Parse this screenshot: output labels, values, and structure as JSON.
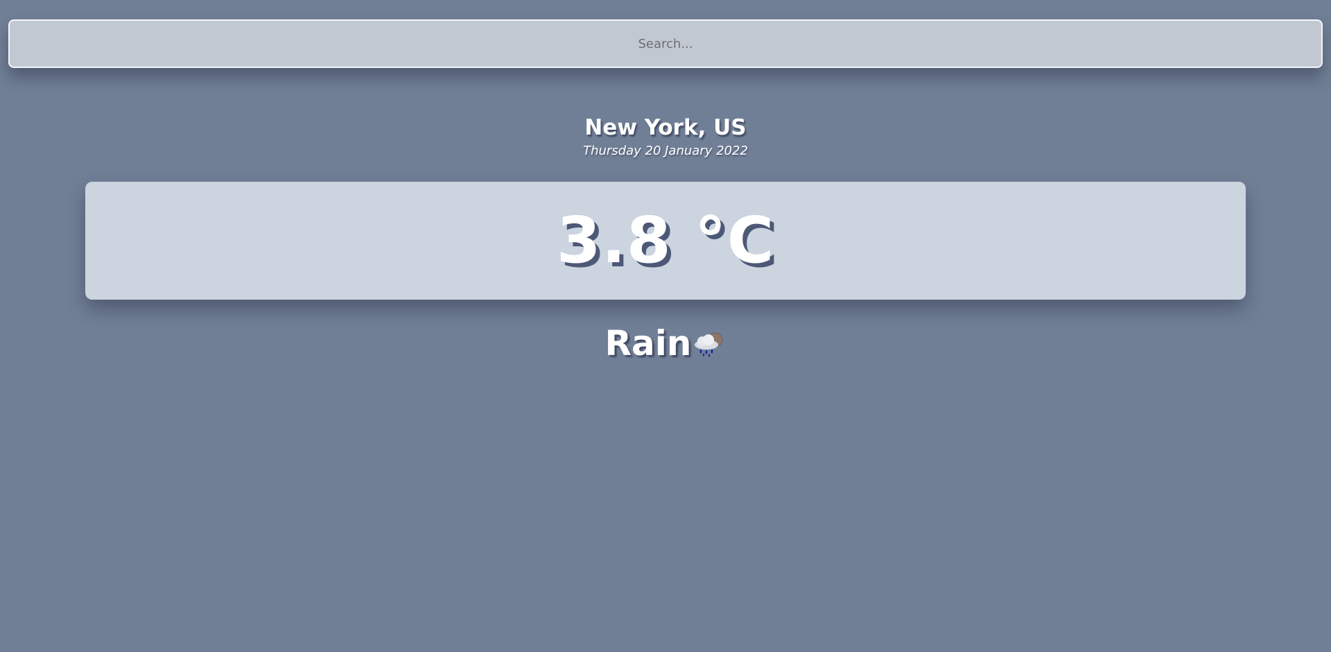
{
  "search": {
    "placeholder": "Search...",
    "value": ""
  },
  "location": {
    "city": "New York, US",
    "date": "Thursday 20 January 2022"
  },
  "temperature": {
    "value": "3.8 °C"
  },
  "weather": {
    "description": "Rain",
    "icon": "rain-cloud-icon"
  },
  "colors": {
    "background": "#717f96",
    "card": "#cbd4df",
    "search_bg": "#c2c8d2",
    "text": "#ffffff"
  }
}
